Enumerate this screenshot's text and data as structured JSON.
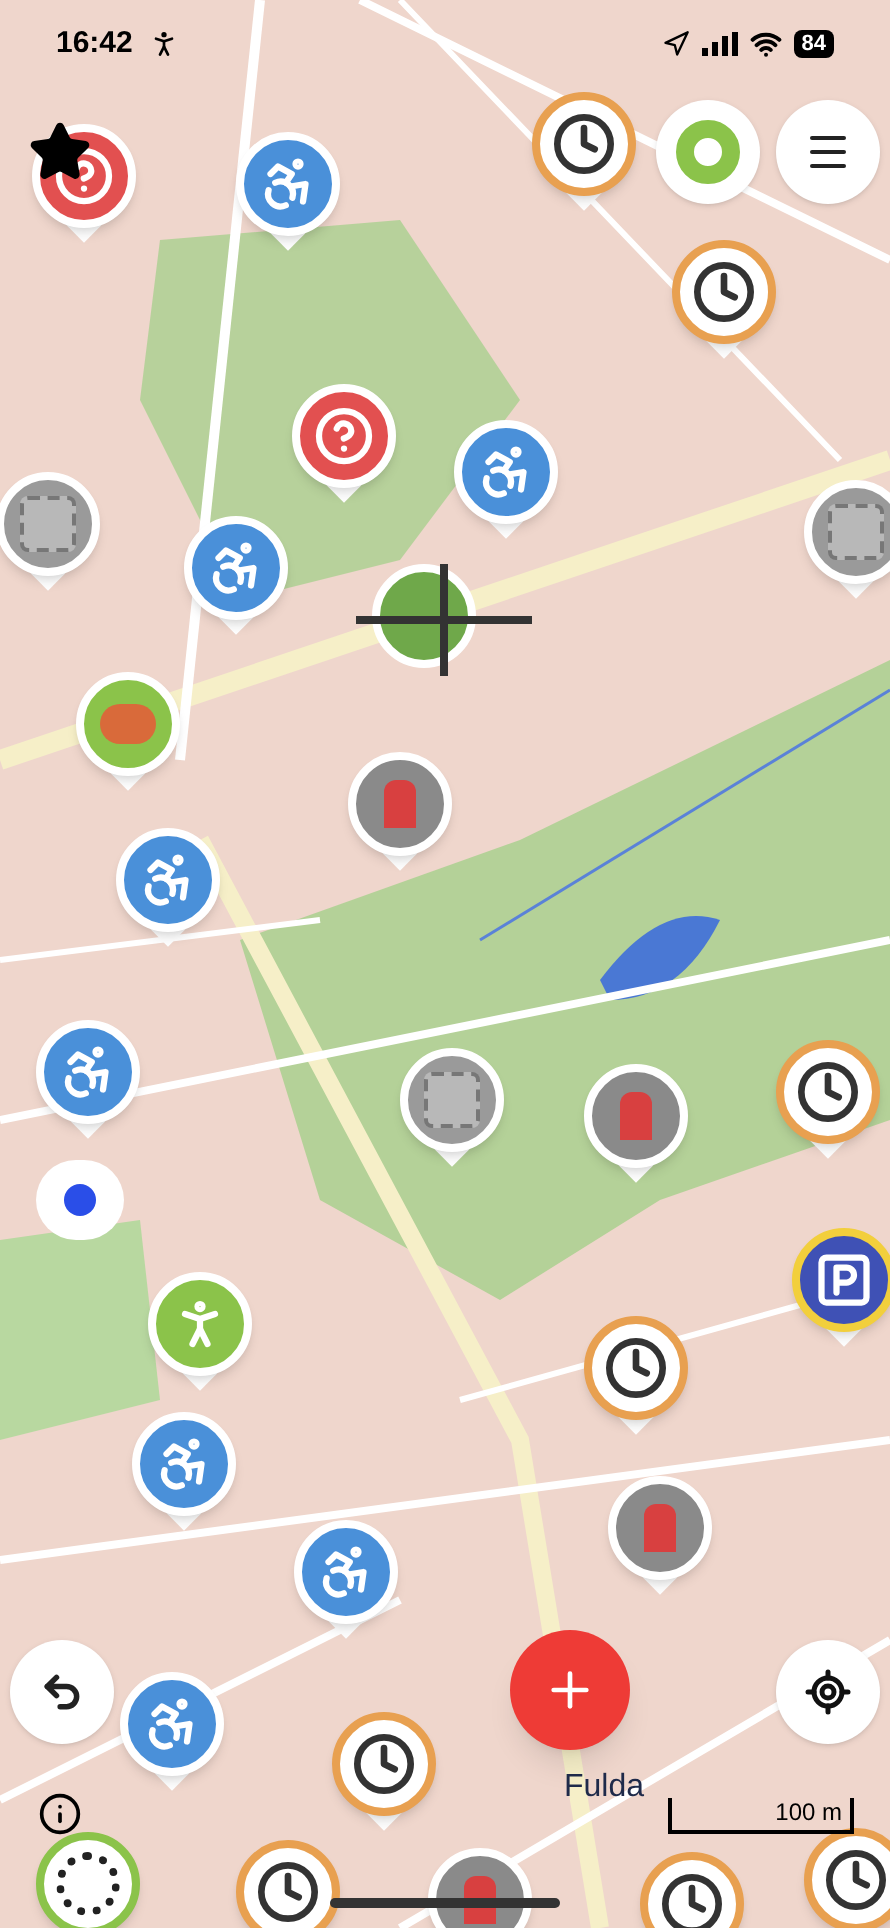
{
  "status_bar": {
    "time": "16:42",
    "battery": "84"
  },
  "map": {
    "place_label": "Fulda",
    "scale_label": "100 m"
  }
}
